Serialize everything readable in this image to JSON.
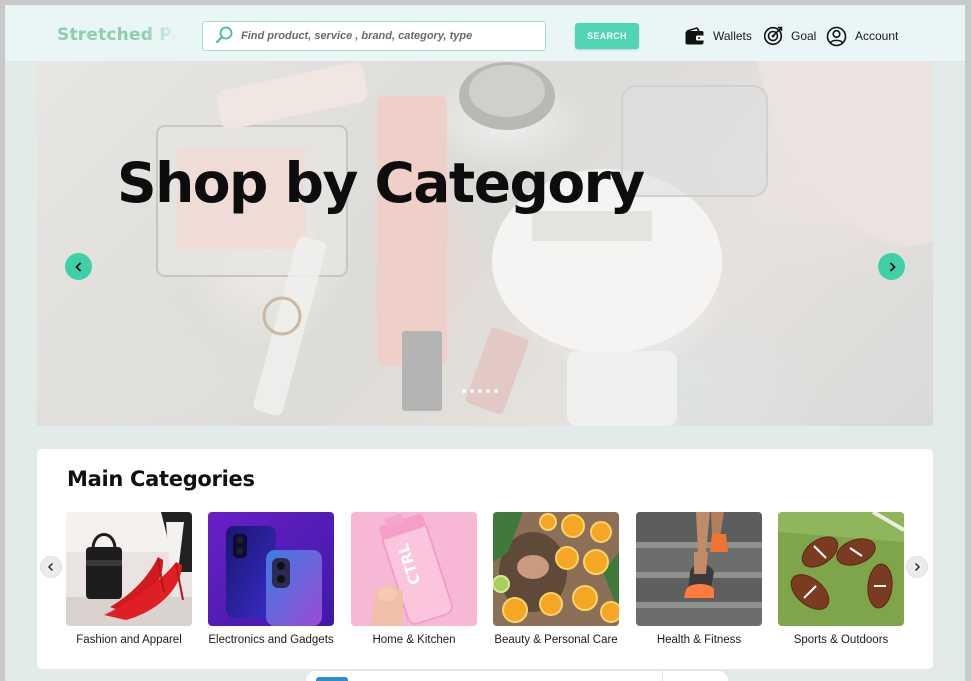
{
  "header": {
    "logo": "Stretched Pay",
    "search_placeholder": "Find product, service , brand, category, type",
    "search_button": "SEARCH",
    "nav": {
      "wallets": "Wallets",
      "goal": "Goal",
      "account": "Account"
    },
    "icons": {
      "search": "search-icon",
      "wallets": "wallet-icon",
      "goal": "target-icon",
      "account": "user-circle-icon"
    }
  },
  "hero": {
    "title": "Shop by Category",
    "slide_count": 5,
    "active_slide": 1
  },
  "categories": {
    "title": "Main Categories",
    "items": [
      {
        "label": "Fashion and Apparel"
      },
      {
        "label": "Electronics and Gadgets"
      },
      {
        "label": "Home & Kitchen"
      },
      {
        "label": "Beauty & Personal Care"
      },
      {
        "label": "Health & Fitness"
      },
      {
        "label": "Sports & Outdoors"
      }
    ]
  },
  "colors": {
    "accent": "#4fd4b4",
    "hero_arrow": "#3fcfa9",
    "logo": "#8ccfae",
    "page_bg": "#e3eaea"
  }
}
